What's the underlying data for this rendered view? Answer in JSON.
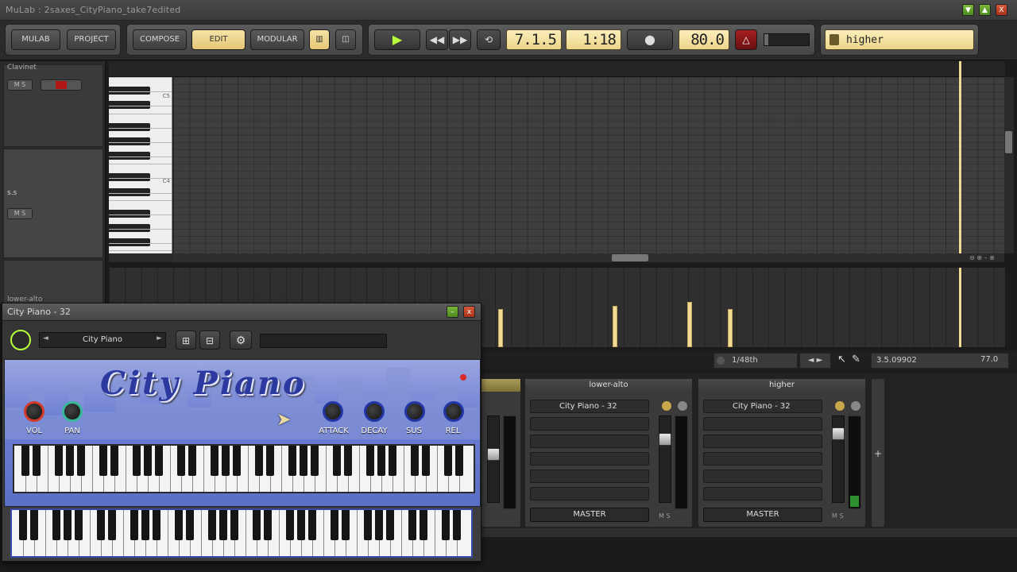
{
  "window": {
    "title": "MuLab : 2saxes_CityPiano_take7edited",
    "minimize_label": "▼",
    "maximize_label": "▲",
    "close_label": "X"
  },
  "toolbar": {
    "mulab": "MULAB",
    "project": "PROJECT",
    "compose": "COMPOSE",
    "edit": "EDIT",
    "modular": "MODULAR",
    "position": "7.1.5",
    "time": "1:18",
    "tempo": "80.0",
    "preset_name": "higher"
  },
  "tracks": [
    {
      "name": "Clavinet",
      "mute": "M",
      "solo": "S"
    },
    {
      "name": "lower-alto",
      "mute": "M",
      "solo": "S"
    }
  ],
  "track_middle_label": "s.s",
  "piano_roll": {
    "key_labels": [
      "C5",
      "C4"
    ],
    "velocity_bars": [
      0.48,
      0.52,
      0.57,
      0.48
    ]
  },
  "status": {
    "grid": "1/48th",
    "position": "3.5.09902",
    "value": "77.0"
  },
  "mixer": {
    "channels": [
      {
        "name": "lower-alto",
        "instrument": "City Piano - 32",
        "master": "MASTER",
        "fader_level": 0.78
      },
      {
        "name": "higher",
        "instrument": "City Piano - 32",
        "master": "MASTER",
        "fader_level": 0.85
      }
    ],
    "add_label": "+",
    "mute": "M",
    "solo": "S"
  },
  "plugin": {
    "title": "City Piano - 32",
    "preset": "City Piano",
    "logo": "City Piano",
    "knobs": [
      "VOL",
      "PAN",
      "ATTACK",
      "DECAY",
      "SUS",
      "REL"
    ],
    "prev": "◄",
    "next": "►"
  }
}
